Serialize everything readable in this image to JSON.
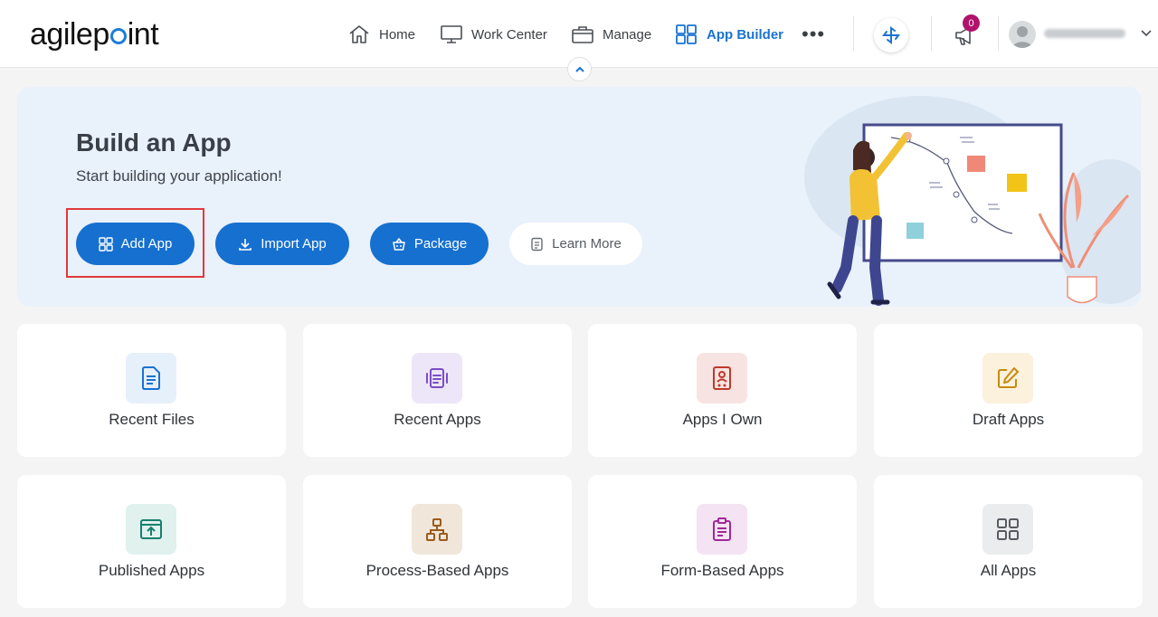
{
  "header": {
    "logo": "agilepoint",
    "nav": {
      "home": "Home",
      "work_center": "Work Center",
      "manage": "Manage",
      "app_builder": "App Builder"
    },
    "notification_count": "0",
    "username": "hidden-user"
  },
  "hero": {
    "title": "Build an App",
    "subtitle": "Start building your application!",
    "buttons": {
      "add_app": "Add App",
      "import_app": "Import App",
      "package": "Package",
      "learn_more": "Learn More"
    }
  },
  "cards": [
    {
      "label": "Recent Files",
      "icon": "document-icon",
      "color": "#1a73d1",
      "bg": "#e6f0fb"
    },
    {
      "label": "Recent Apps",
      "icon": "recent-apps-icon",
      "color": "#7a4fc4",
      "bg": "#ede6f8"
    },
    {
      "label": "Apps I Own",
      "icon": "person-card-icon",
      "color": "#c0392b",
      "bg": "#f7e4e2"
    },
    {
      "label": "Draft Apps",
      "icon": "edit-icon",
      "color": "#c88a12",
      "bg": "#fbf1dc"
    },
    {
      "label": "Published Apps",
      "icon": "publish-icon",
      "color": "#16806f",
      "bg": "#e0f1ee"
    },
    {
      "label": "Process-Based Apps",
      "icon": "hierarchy-icon",
      "color": "#9a5b1c",
      "bg": "#f1e6da"
    },
    {
      "label": "Form-Based Apps",
      "icon": "clipboard-icon",
      "color": "#a0289a",
      "bg": "#f4e3f2"
    },
    {
      "label": "All Apps",
      "icon": "grid-icon",
      "color": "#555b62",
      "bg": "#ebeced"
    }
  ],
  "colors": {
    "primary": "#1670d0",
    "highlight": "#e03a3a",
    "badge": "#b0136c"
  }
}
